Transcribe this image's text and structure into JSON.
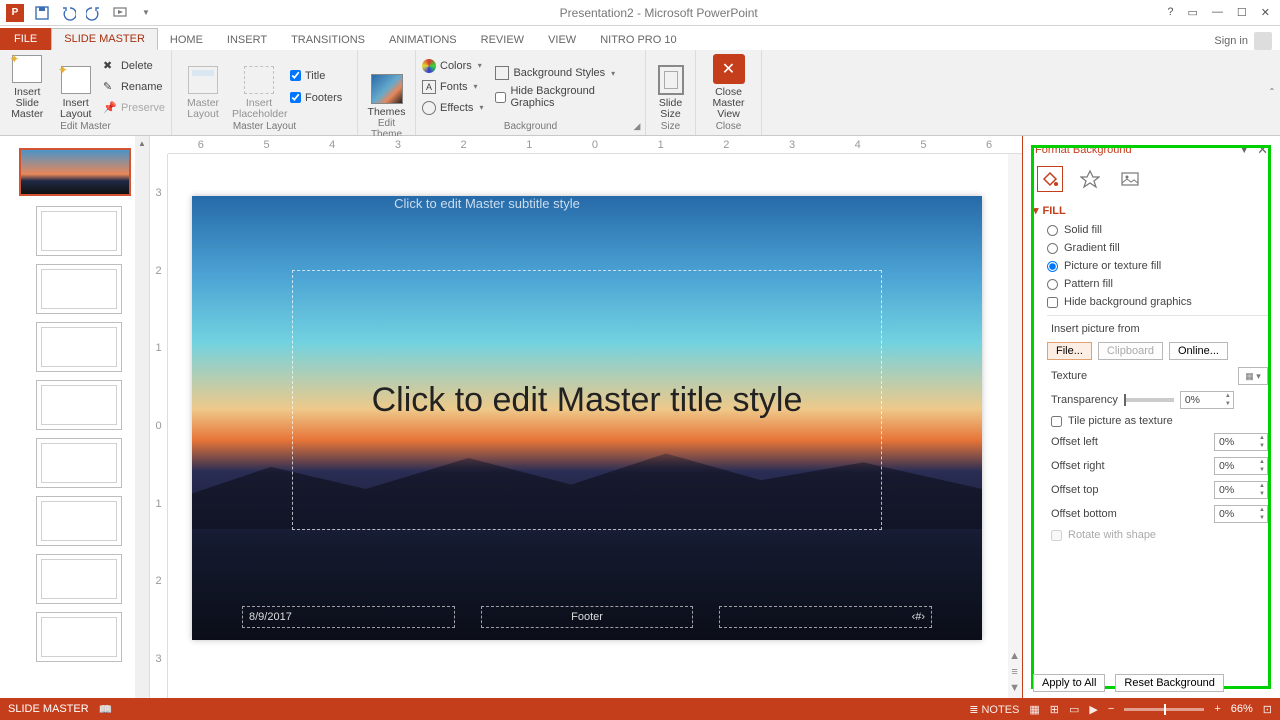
{
  "window": {
    "title": "Presentation2 - Microsoft PowerPoint"
  },
  "qat": {
    "save": "Save",
    "undo": "Undo",
    "redo": "Redo",
    "start": "Start From Beginning"
  },
  "tabs": {
    "file": "FILE",
    "items": [
      "SLIDE MASTER",
      "HOME",
      "INSERT",
      "TRANSITIONS",
      "ANIMATIONS",
      "REVIEW",
      "VIEW",
      "NITRO PRO 10"
    ],
    "active_index": 0,
    "signin": "Sign in"
  },
  "ribbon": {
    "groups": {
      "edit_master": {
        "label": "Edit Master",
        "insert_slide_master": "Insert Slide\nMaster",
        "insert_layout": "Insert\nLayout",
        "delete": "Delete",
        "rename": "Rename",
        "preserve": "Preserve"
      },
      "master_layout": {
        "label": "Master Layout",
        "master_layout_btn": "Master\nLayout",
        "insert_placeholder": "Insert\nPlaceholder",
        "title_cb": "Title",
        "footers_cb": "Footers"
      },
      "edit_theme": {
        "label": "Edit Theme",
        "themes": "Themes"
      },
      "background": {
        "label": "Background",
        "colors": "Colors",
        "fonts": "Fonts",
        "effects": "Effects",
        "bg_styles": "Background Styles",
        "hide_bg": "Hide Background Graphics"
      },
      "size": {
        "label": "Size",
        "slide_size": "Slide\nSize"
      },
      "close": {
        "label": "Close",
        "close_master": "Close\nMaster View"
      }
    }
  },
  "ruler": {
    "h": [
      "6",
      "5",
      "4",
      "3",
      "2",
      "1",
      "0",
      "1",
      "2",
      "3",
      "4",
      "5",
      "6"
    ],
    "v": [
      "3",
      "2",
      "1",
      "0",
      "1",
      "2",
      "3"
    ]
  },
  "slide": {
    "title_ph": "Click to edit Master title style",
    "subtitle_ph": "Click to edit Master subtitle style",
    "date": "8/9/2017",
    "footer": "Footer",
    "slidenum": "‹#›"
  },
  "format_background": {
    "panel_title": "Format Background",
    "section_fill": "FILL",
    "solid": "Solid fill",
    "gradient": "Gradient fill",
    "picture": "Picture or texture fill",
    "pattern": "Pattern fill",
    "hide_bg": "Hide background graphics",
    "insert_from": "Insert picture from",
    "file_btn": "File...",
    "clipboard_btn": "Clipboard",
    "online_btn": "Online...",
    "texture": "Texture",
    "transparency": "Transparency",
    "transparency_val": "0%",
    "tile": "Tile picture as texture",
    "offset_left": "Offset left",
    "offset_right": "Offset right",
    "offset_top": "Offset top",
    "offset_bottom": "Offset bottom",
    "offset_val": "0%",
    "rotate": "Rotate with shape",
    "apply_all": "Apply to All",
    "reset": "Reset Background"
  },
  "statusbar": {
    "mode": "SLIDE MASTER",
    "notes": "NOTES",
    "zoom": "66%"
  }
}
